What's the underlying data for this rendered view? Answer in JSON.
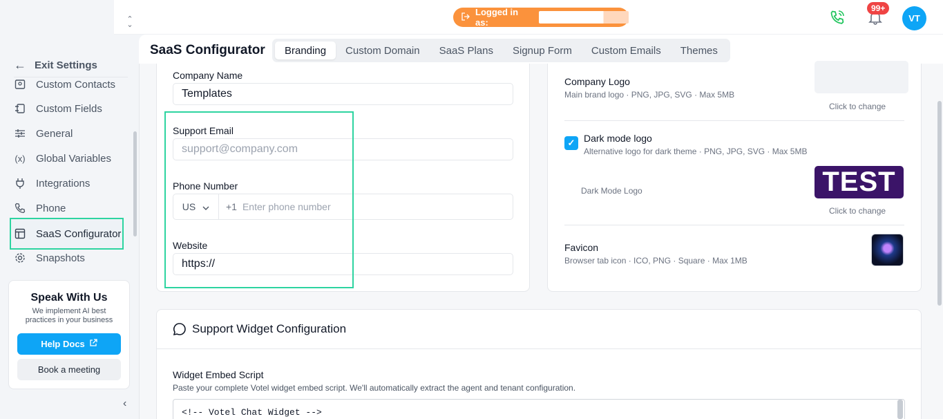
{
  "sidebar": {
    "exit_label": "Exit Settings",
    "items": [
      {
        "label": "Custom Contacts",
        "icon": "contact-card-icon"
      },
      {
        "label": "Custom Fields",
        "icon": "fields-icon"
      },
      {
        "label": "General",
        "icon": "sliders-icon"
      },
      {
        "label": "Global Variables",
        "icon": "variable-icon"
      },
      {
        "label": "Integrations",
        "icon": "plug-icon"
      },
      {
        "label": "Phone",
        "icon": "phone-icon"
      },
      {
        "label": "SaaS Configurator",
        "icon": "layout-icon",
        "active": true
      },
      {
        "label": "Snapshots",
        "icon": "gear-icon"
      }
    ],
    "promo": {
      "title": "Speak With Us",
      "text": "We implement AI best practices in your business",
      "help_label": "Help Docs",
      "meeting_label": "Book a meeting"
    }
  },
  "header": {
    "logged_in_label": "Logged in as:",
    "notification_count": "99+",
    "avatar_initials": "VT",
    "phone_color": "#22c55e"
  },
  "page": {
    "title": "SaaS Configurator",
    "tabs": [
      "Branding",
      "Custom Domain",
      "SaaS Plans",
      "Signup Form",
      "Custom Emails",
      "Themes"
    ],
    "active_tab": "Branding"
  },
  "form": {
    "company_name_label": "Company Name",
    "company_name_value": "Templates",
    "support_email_label": "Support Email",
    "support_email_placeholder": "support@company.com",
    "phone_label": "Phone Number",
    "phone_country": "US",
    "phone_prefix": "+1",
    "phone_placeholder": "Enter phone number",
    "website_label": "Website",
    "website_value": "https://"
  },
  "logos": {
    "company_logo_title": "Company Logo",
    "company_logo_sub": "Main brand logo · PNG, JPG, SVG · Max 5MB",
    "click_change": "Click to change",
    "dark_title": "Dark mode logo",
    "dark_sub": "Alternative logo for dark theme · PNG, JPG, SVG · Max 5MB",
    "dark_checked": true,
    "dark_preview_label": "Dark Mode Logo",
    "dark_logo_text": "TEST",
    "click_change_2": "Click to change",
    "favicon_title": "Favicon",
    "favicon_sub": "Browser tab icon · ICO, PNG · Square · Max 1MB"
  },
  "widget": {
    "title": "Support Widget Configuration",
    "embed_label": "Widget Embed Script",
    "embed_help": "Paste your complete Votel widget embed script. We'll automatically extract the agent and tenant configuration.",
    "embed_value": "<!-- Votel Chat Widget -->"
  }
}
